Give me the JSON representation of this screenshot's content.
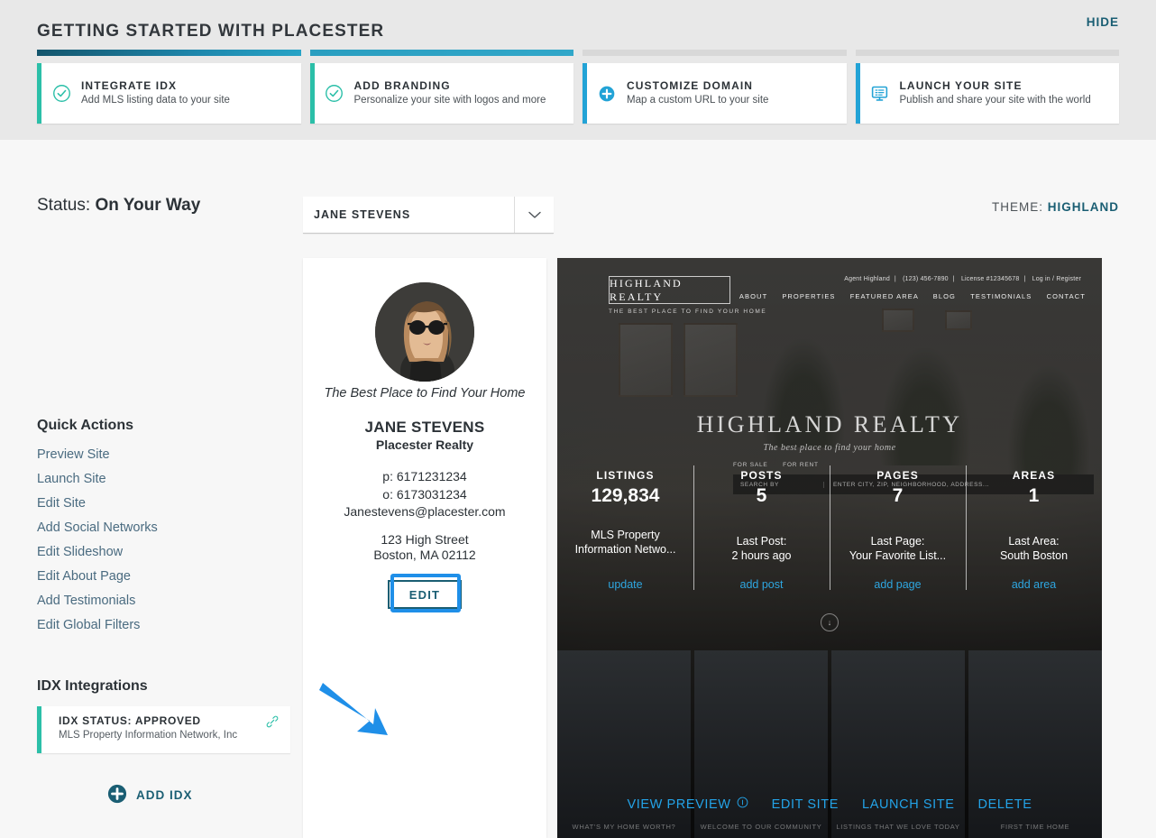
{
  "onboarding": {
    "title": "GETTING STARTED WITH PLACESTER",
    "hide_label": "HIDE",
    "steps": [
      {
        "title": "INTEGRATE IDX",
        "desc": "Add MLS listing data to your site",
        "icon": "check-circle-icon",
        "state": "complete"
      },
      {
        "title": "ADD BRANDING",
        "desc": "Personalize your site with logos and more",
        "icon": "check-circle-icon",
        "state": "complete"
      },
      {
        "title": "CUSTOMIZE DOMAIN",
        "desc": "Map a custom URL to your site",
        "icon": "plus-circle-icon",
        "state": "todo"
      },
      {
        "title": "LAUNCH YOUR SITE",
        "desc": "Publish and share your site with the world",
        "icon": "monitor-icon",
        "state": "todo"
      }
    ]
  },
  "status": {
    "label": "Status:",
    "value": "On Your Way"
  },
  "site_select": {
    "value": "JANE STEVENS",
    "caret_icon": "chevron-down-icon"
  },
  "theme": {
    "label": "THEME:",
    "value": "HIGHLAND"
  },
  "quick_actions": {
    "title": "Quick Actions",
    "items": [
      "Preview Site",
      "Launch Site",
      "Edit Site",
      "Add Social Networks",
      "Edit Slideshow",
      "Edit About Page",
      "Add Testimonials",
      "Edit Global Filters"
    ]
  },
  "idx": {
    "title": "IDX Integrations",
    "status": "IDX STATUS: APPROVED",
    "provider": "MLS Property Information Network, Inc",
    "link_icon": "chain-link-icon",
    "add_label": "ADD IDX",
    "add_icon": "plus-circle-icon"
  },
  "profile": {
    "avatar_name": "agent-avatar",
    "tagline": "The Best Place to Find Your Home",
    "name": "JANE STEVENS",
    "company": "Placester Realty",
    "phone": "p: 6171231234",
    "office": "o: 6173031234",
    "email": "Janestevens@placester.com",
    "address_line1": "123 High Street",
    "address_line2": "Boston, MA 02112",
    "edit_label": "EDIT"
  },
  "preview": {
    "logo": "HIGHLAND REALTY",
    "logo_sub": "THE BEST PLACE TO FIND YOUR HOME",
    "topbar": [
      "Agent Highland",
      "(123) 456-7890",
      "License #12345678",
      "Log in / Register"
    ],
    "nav": [
      "ABOUT",
      "PROPERTIES",
      "FEATURED AREA",
      "BLOG",
      "TESTIMONIALS",
      "CONTACT"
    ],
    "hero_title": "HIGHLAND REALTY",
    "hero_sub": "The best place to find your home",
    "search_tabs": [
      "FOR SALE",
      "FOR RENT"
    ],
    "search_by": "SEARCH BY",
    "search_placeholder": "ENTER CITY, ZIP, NEIGHBORHOOD, ADDRESS...",
    "scroll_icon": "arrow-down-icon",
    "tiles": [
      "WHAT'S MY HOME WORTH?",
      "WELCOME TO OUR COMMUNITY",
      "LISTINGS THAT WE LOVE TODAY",
      "FIRST TIME HOME"
    ],
    "stats": [
      {
        "label": "LISTINGS",
        "value": "129,834",
        "sub": "MLS Property Information Netwo...",
        "link": "update"
      },
      {
        "label": "POSTS",
        "value": "5",
        "sub": "Last Post:\n2 hours ago",
        "link": "add post"
      },
      {
        "label": "PAGES",
        "value": "7",
        "sub": "Last Page:\nYour Favorite List...",
        "link": "add page"
      },
      {
        "label": "AREAS",
        "value": "1",
        "sub": "Last Area:\nSouth Boston",
        "link": "add area"
      }
    ],
    "actions": [
      {
        "label": "VIEW PREVIEW",
        "icon": "info-icon"
      },
      {
        "label": "EDIT SITE",
        "icon": ""
      },
      {
        "label": "LAUNCH SITE",
        "icon": ""
      },
      {
        "label": "DELETE",
        "icon": ""
      }
    ]
  },
  "annotation": {
    "arrow": "blue-arrow-pointer",
    "highlight": "edit-button-highlight",
    "color": "#1f8fe8"
  },
  "colors": {
    "teal_accent": "#2bbfa8",
    "blue_accent": "#23a3d6",
    "dark_teal": "#1a5e73",
    "link_blue": "#4a6b80",
    "preview_link": "#23a3e8"
  }
}
